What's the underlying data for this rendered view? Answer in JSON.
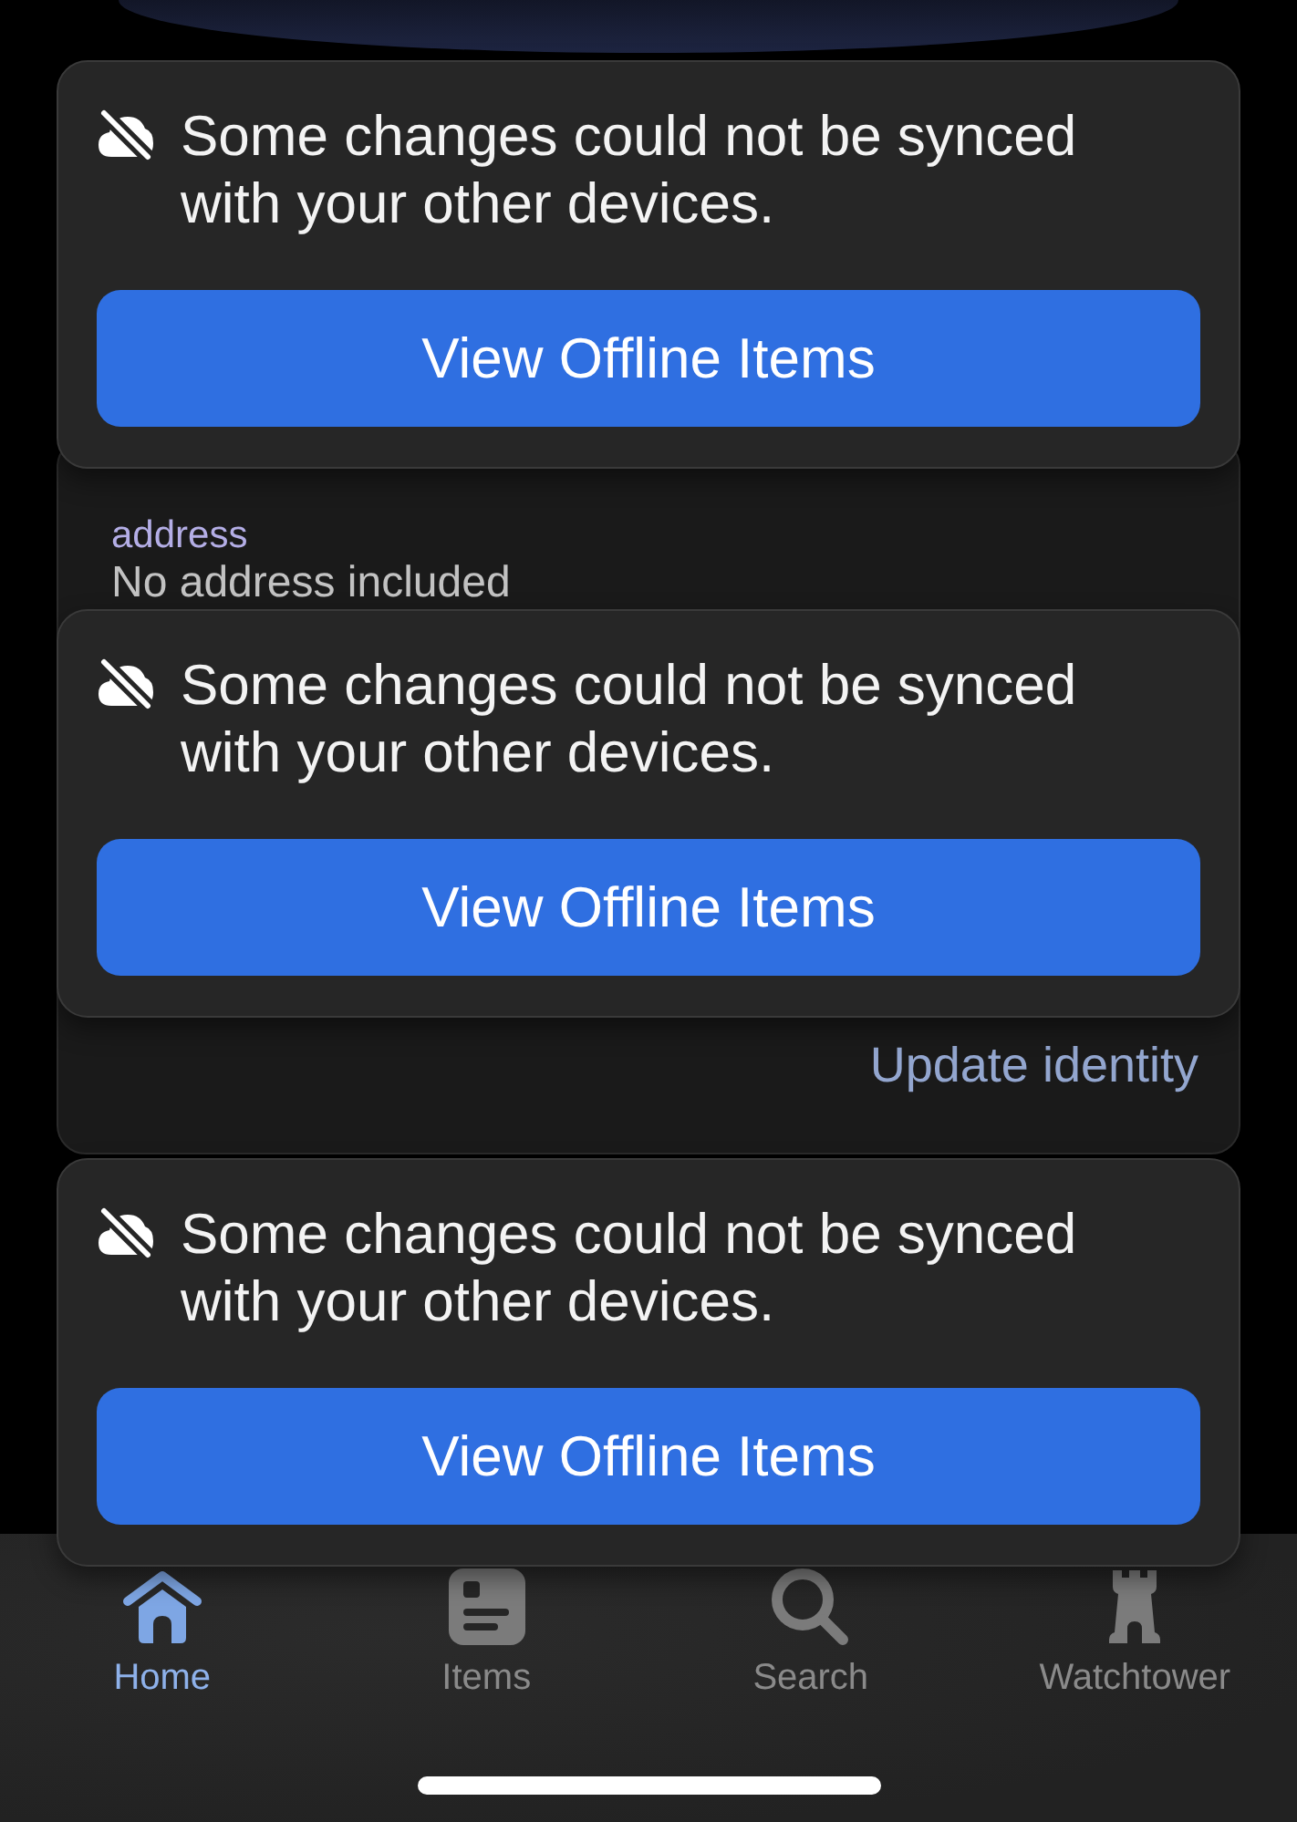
{
  "toasts": [
    {
      "message": "Some changes could not be synced with your other devices.",
      "button": "View Offline Items"
    },
    {
      "message": "Some changes could not be synced with your other devices.",
      "button": "View Offline Items"
    },
    {
      "message": "Some changes could not be synced with your other devices.",
      "button": "View Offline Items"
    }
  ],
  "identity_card": {
    "fields": [
      {
        "label": "address",
        "value": "No address included"
      }
    ],
    "action": "Update identity"
  },
  "tab_bar": {
    "tabs": [
      {
        "label": "Home",
        "selected": true
      },
      {
        "label": "Items",
        "selected": false
      },
      {
        "label": "Search",
        "selected": false
      },
      {
        "label": "Watchtower",
        "selected": false
      }
    ]
  }
}
